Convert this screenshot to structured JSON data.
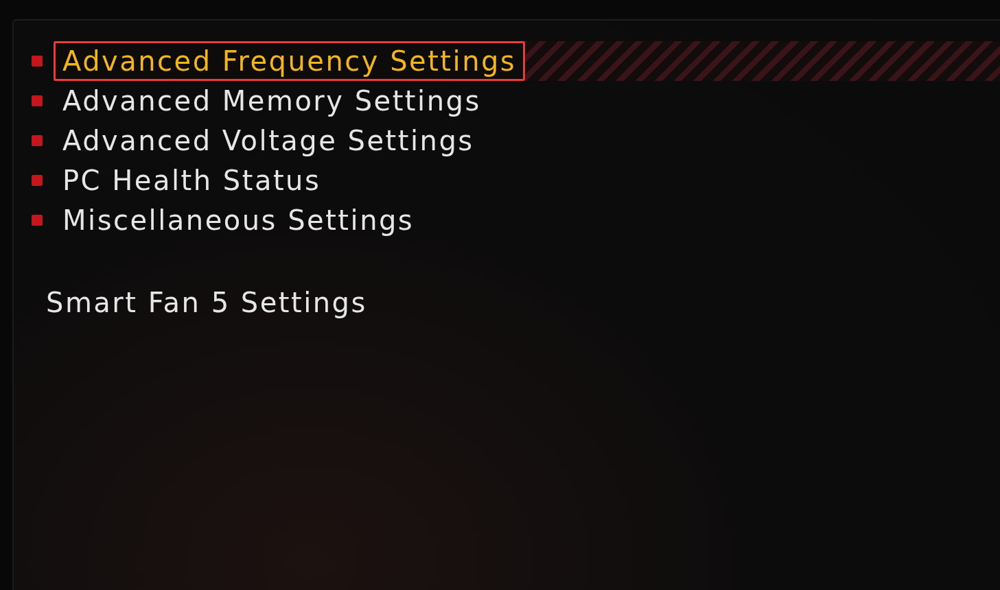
{
  "menu": {
    "items": [
      {
        "label": "Advanced Frequency Settings",
        "kind": "submenu",
        "selected": true,
        "annotated": true
      },
      {
        "label": "Advanced Memory Settings",
        "kind": "submenu",
        "selected": false,
        "annotated": false
      },
      {
        "label": "Advanced Voltage Settings",
        "kind": "submenu",
        "selected": false,
        "annotated": false
      },
      {
        "label": "PC Health Status",
        "kind": "submenu",
        "selected": false,
        "annotated": false
      },
      {
        "label": "Miscellaneous Settings",
        "kind": "submenu",
        "selected": false,
        "annotated": false
      },
      {
        "label": "Smart Fan 5 Settings",
        "kind": "plain",
        "selected": false,
        "annotated": false
      }
    ]
  }
}
